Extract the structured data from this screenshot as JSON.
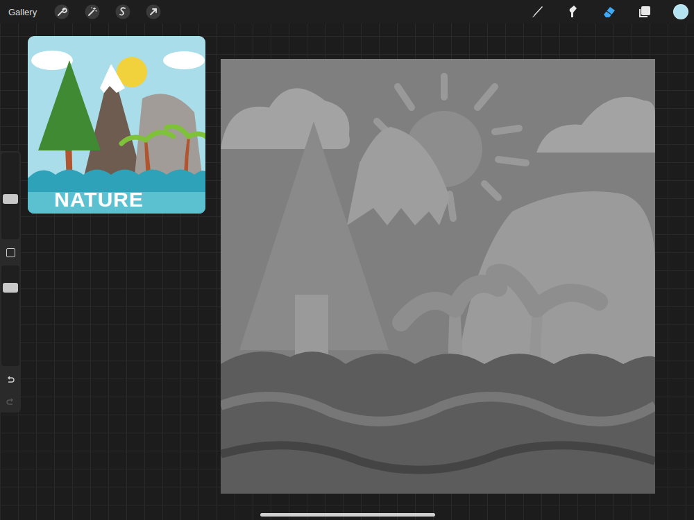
{
  "toolbar": {
    "gallery": "Gallery",
    "actions": [
      {
        "kind": "wrench"
      },
      {
        "kind": "wand"
      },
      {
        "kind": "selection"
      },
      {
        "kind": "transform"
      }
    ],
    "tools": [
      {
        "kind": "brush",
        "selected": false
      },
      {
        "kind": "smudge",
        "selected": false
      },
      {
        "kind": "eraser",
        "selected": true
      },
      {
        "kind": "layers",
        "selected": false
      }
    ],
    "color": "#b3e3f0"
  },
  "sidebar": {
    "size": {
      "level": 0.46
    },
    "opacity": {
      "level": 0.81
    },
    "undo": {
      "disabled": false
    },
    "redo": {
      "disabled": true
    }
  },
  "reference": {
    "caption": "NATURE"
  }
}
